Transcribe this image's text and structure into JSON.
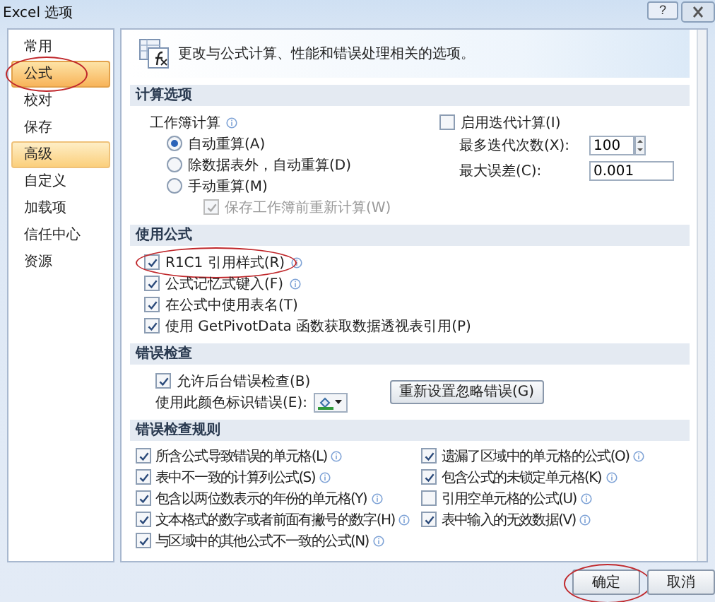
{
  "window": {
    "title": "Excel 选项",
    "help": "?"
  },
  "sidebar": {
    "items": [
      {
        "label": "常用",
        "selected": false,
        "hovered": false,
        "annotated": false
      },
      {
        "label": "公式",
        "selected": true,
        "hovered": false,
        "annotated": true
      },
      {
        "label": "校对",
        "selected": false,
        "hovered": false,
        "annotated": false
      },
      {
        "label": "保存",
        "selected": false,
        "hovered": false,
        "annotated": false
      },
      {
        "label": "高级",
        "selected": false,
        "hovered": true,
        "annotated": false
      },
      {
        "label": "自定义",
        "selected": false,
        "hovered": false,
        "annotated": false
      },
      {
        "label": "加载项",
        "selected": false,
        "hovered": false,
        "annotated": false
      },
      {
        "label": "信任中心",
        "selected": false,
        "hovered": false,
        "annotated": false
      },
      {
        "label": "资源",
        "selected": false,
        "hovered": false,
        "annotated": false
      }
    ]
  },
  "header": {
    "text": "更改与公式计算、性能和错误处理相关的选项。"
  },
  "calculation": {
    "title": "计算选项",
    "workbook_label": "工作簿计算",
    "modes": [
      {
        "label": "自动重算(A)",
        "selected": true
      },
      {
        "label": "除数据表外，自动重算(D)",
        "selected": false
      },
      {
        "label": "手动重算(M)",
        "selected": false
      }
    ],
    "recalc_before_save": {
      "label": "保存工作簿前重新计算(W)",
      "checked": true,
      "disabled": true
    },
    "iteration": {
      "label": "启用迭代计算(I)",
      "checked": false
    },
    "max_iterations": {
      "label": "最多迭代次数(X):",
      "value": "100"
    },
    "max_change": {
      "label": "最大误差(C):",
      "value": "0.001"
    }
  },
  "formulas": {
    "title": "使用公式",
    "options": [
      {
        "label": "R1C1 引用样式(R)",
        "checked": true,
        "info": true,
        "annotated": true
      },
      {
        "label": "公式记忆式键入(F)",
        "checked": true,
        "info": true,
        "annotated": false
      },
      {
        "label": "在公式中使用表名(T)",
        "checked": true,
        "info": false,
        "annotated": false
      },
      {
        "label": "使用 GetPivotData 函数获取数据透视表引用(P)",
        "checked": true,
        "info": false,
        "annotated": false
      }
    ]
  },
  "error_checking": {
    "title": "错误检查",
    "background": {
      "label": "允许后台错误检查(B)",
      "checked": true
    },
    "color_label": "使用此颜色标识错误(E):",
    "reset_button": "重新设置忽略错误(G)"
  },
  "error_rules": {
    "title": "错误检查规则",
    "left": [
      {
        "label": "所含公式导致错误的单元格(L)",
        "checked": true
      },
      {
        "label": "表中不一致的计算列公式(S)",
        "checked": true
      },
      {
        "label": "包含以两位数表示的年份的单元格(Y)",
        "checked": true
      },
      {
        "label": "文本格式的数字或者前面有撇号的数字(H)",
        "checked": true
      },
      {
        "label": "与区域中的其他公式不一致的公式(N)",
        "checked": true
      }
    ],
    "right": [
      {
        "label": "遗漏了区域中的单元格的公式(O)",
        "checked": true
      },
      {
        "label": "包含公式的未锁定单元格(K)",
        "checked": true
      },
      {
        "label": "引用空单元格的公式(U)",
        "checked": false
      },
      {
        "label": "表中输入的无效数据(V)",
        "checked": true
      }
    ]
  },
  "buttons": [
    {
      "label": "确定",
      "annotated": true
    },
    {
      "label": "取消",
      "annotated": false
    }
  ]
}
